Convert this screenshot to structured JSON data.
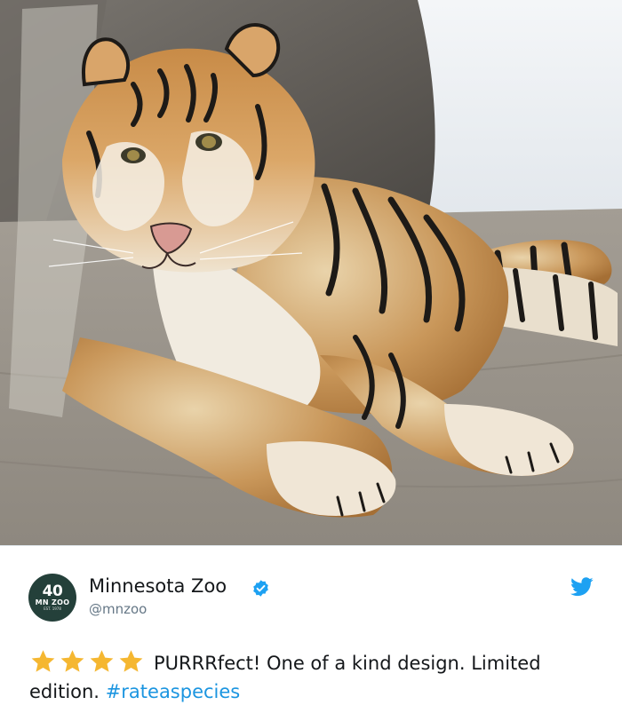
{
  "photo": {
    "subject": "Siberian tiger lying on stone ground"
  },
  "account": {
    "avatar_number": "40",
    "avatar_text": "MN ZOO",
    "avatar_subtext": "EST. 1978",
    "display_name": "Minnesota Zoo",
    "handle": "@mnzoo",
    "verified": true
  },
  "tweet": {
    "stars": 4,
    "text": "PURRRfect! One of a kind design. Limited edition.",
    "hashtag": "#rateaspecies"
  },
  "icons": {
    "verified": "verified-badge-icon",
    "brand": "twitter-bird-icon",
    "rating": "star-icon"
  },
  "colors": {
    "twitter_blue": "#1da1f2",
    "hashtag_blue": "#1b95e0",
    "star_gold": "#f5b731",
    "avatar_green": "#24403a",
    "text": "#14171a",
    "muted": "#657786"
  }
}
